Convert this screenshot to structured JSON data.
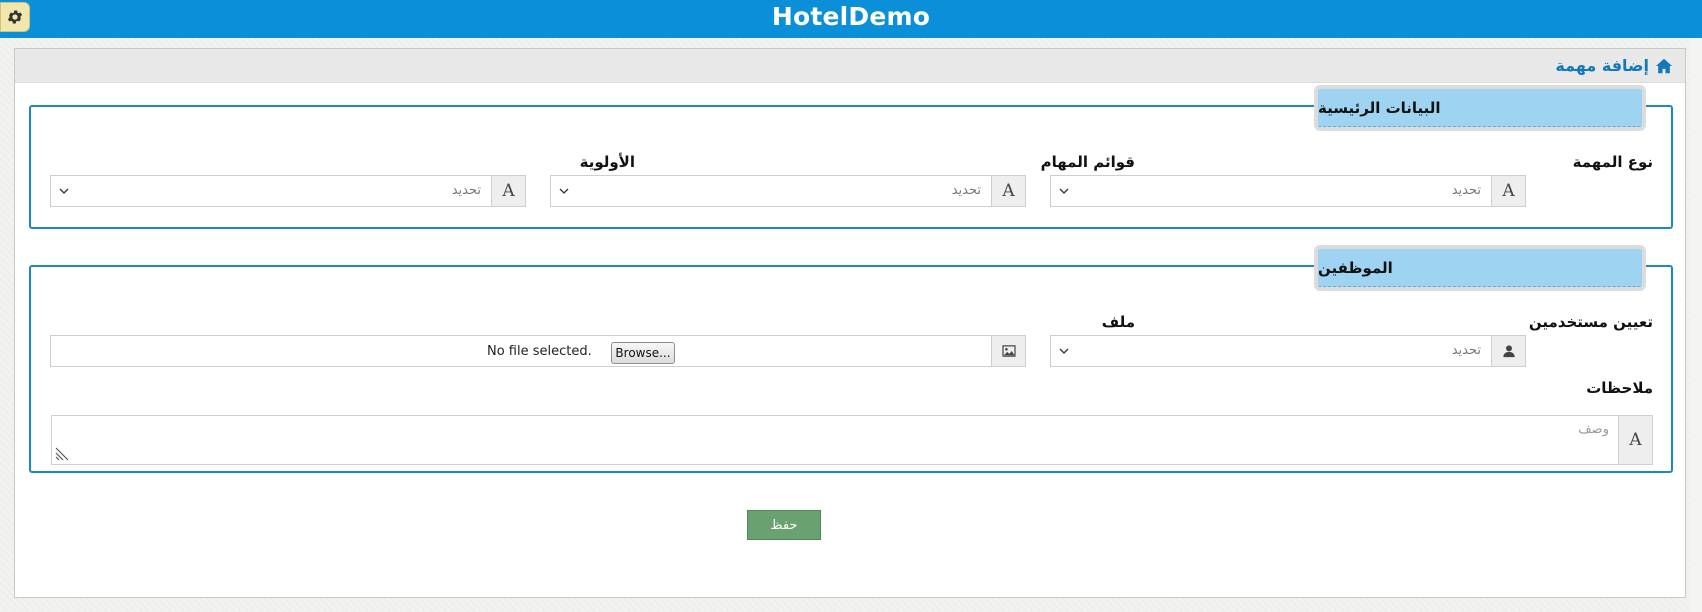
{
  "app": {
    "title": "HotelDemo"
  },
  "breadcrumb": {
    "title": "إضافة مهمة",
    "icon": "home-icon"
  },
  "main_section": {
    "title": "البيانات الرئيسية",
    "fields": {
      "task_type": {
        "label": "نوع المهمة",
        "value": "تحديد",
        "icon": "font-icon"
      },
      "task_lists": {
        "label": "قوائم المهام",
        "value": "تحديد",
        "icon": "font-icon"
      },
      "priority": {
        "label": "الأولوية",
        "value": "تحديد",
        "icon": "font-icon"
      }
    }
  },
  "employees_section": {
    "title": "الموظفين",
    "fields": {
      "assign_users": {
        "label": "تعيين مستخدمين",
        "value": "تحديد",
        "icon": "user-icon"
      },
      "file": {
        "label": "ملف",
        "browse_label": "Browse...",
        "status": "No file selected.",
        "icon": "image-icon"
      },
      "notes": {
        "label": "ملاحظات",
        "placeholder": "وصف",
        "icon": "font-icon"
      }
    }
  },
  "actions": {
    "save_label": "حفظ"
  },
  "colors": {
    "topbar": "#0a8fd8",
    "legend": "#9ed3f1",
    "border": "#1b87cf",
    "save": "#6aa171",
    "gear_bg": "#f1e7ac"
  }
}
